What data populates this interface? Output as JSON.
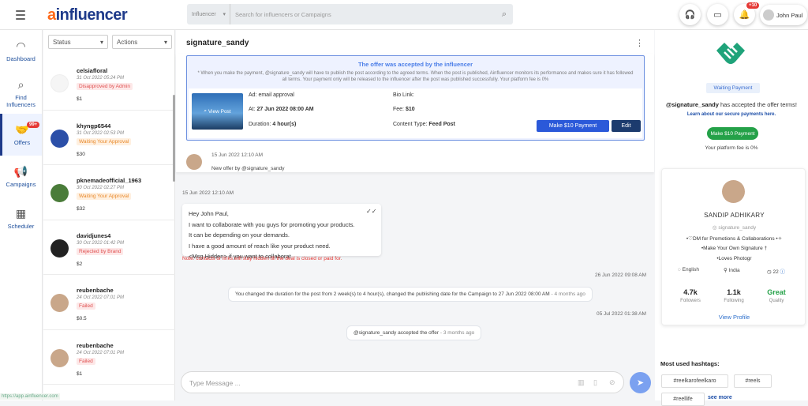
{
  "app": {
    "logo_a": "a",
    "logo_rest": "influencer"
  },
  "search": {
    "category": "Influencer",
    "placeholder": "Search for influencers or Campaigns"
  },
  "header": {
    "notifications_badge": "+10",
    "user_name": "John Paul"
  },
  "sidenav": {
    "items": [
      {
        "label": "Dashboard",
        "icon": "dashboard-gauge-icon"
      },
      {
        "label": "Find Influencers",
        "icon": "magnifier-icon"
      },
      {
        "label": "Offers",
        "icon": "handshake-icon",
        "badge": "99+",
        "active": true
      },
      {
        "label": "Campaigns",
        "icon": "megaphone-icon"
      },
      {
        "label": "Scheduler",
        "icon": "calendar-icon"
      }
    ]
  },
  "filters": {
    "status": "Status",
    "actions": "Actions"
  },
  "offers": [
    {
      "name": "celsiafloral",
      "date": "31 Oct 2022 05:24 PM",
      "status": "Disapproved by Admin",
      "status_color": "red",
      "price": "$1"
    },
    {
      "name": "khyngp6544",
      "date": "31 Oct 2022 02:53 PM",
      "status": "Waiting Your Approval",
      "status_color": "orange",
      "price": "$30"
    },
    {
      "name": "pknemadeofficial_1963",
      "date": "30 Oct 2022 02:27 PM",
      "status": "Waiting Your Approval",
      "status_color": "orange",
      "price": "$32"
    },
    {
      "name": "davidjunes4",
      "date": "30 Oct 2022 01:42 PM",
      "status": "Rejected by Brand",
      "status_color": "red",
      "price": "$2"
    },
    {
      "name": "reubenbache",
      "date": "24 Oct 2022 07:01 PM",
      "status": "Failed",
      "status_color": "red",
      "price": "$0.5"
    },
    {
      "name": "reubenbache",
      "date": "24 Oct 2022 07:01 PM",
      "status": "Failed",
      "status_color": "red",
      "price": "$1"
    }
  ],
  "chat": {
    "title": "signature_sandy",
    "offer": {
      "heading": "The offer was accepted by the influencer",
      "description": "* When you make the payment, @signature_sandy will have to publish the post according to the agreed terms. When the post is published, Ainfluencer monitors its performance and makes sure it has followed all terms. Your payment only will be released to the influencer after the post was published successfully. Your platform fee is 0%",
      "view_post": "View Post",
      "ad": "Ad: email approval",
      "at_label": "At:",
      "at_value": "27 Jun 2022 08:00 AM",
      "duration_label": "Duration:",
      "duration_value": "4 hour(s)",
      "bio_link": "Bio Link:",
      "fee_label": "Fee:",
      "fee_value": "$10",
      "content_label": "Content Type:",
      "content_value": "Feed Post",
      "pay_button": "Make $10 Payment",
      "edit_button": "Edit"
    },
    "messages": {
      "m1_time": "15 Jun 2022 12:10 AM",
      "m1_text": "New offer by @signature_sandy",
      "m2_time": "15 Jun 2022 12:10 AM",
      "bubble": [
        "Hey John Paul,",
        "I want to collaborate with you guys for promoting your products.",
        "It can be depending on your demands.",
        "I have a good amount of reach like your product need.",
        "<Msg Hidden> if you want to collaborat"
      ],
      "note": "Note: contacts or links will stay hidden till the deal is closed or paid for.",
      "ts1": "26 Jun 2022 09:08 AM",
      "sys1": "You changed the duration for the post from 2 week(s) to 4 hour(s), changed the publishing date for the Campaign to 27 Jun 2022 08:00 AM",
      "sys1_ago": "- 4 months ago",
      "ts2": "05 Jul 2022 01:38 AM",
      "sys2": "@signature_sandy accepted the offer",
      "sys2_ago": "- 3 months ago"
    },
    "composer_placeholder": "Type Message ..."
  },
  "panel": {
    "status": "Waiting Payment",
    "accepted_user": "@signature_sandy",
    "accepted_text": " has accepted the offer terms!",
    "learn": "Learn about our secure payments here.",
    "pay_button": "Make $10 Payment",
    "platform_fee": "Your platform fee is 0%",
    "profile": {
      "name": "SANDIP ADHIKARY",
      "handle": "signature_sandy",
      "bio": [
        "•♡DM for Promotions & Collaborations •✧",
        "•Make Your Own Signature †",
        "•Loves Photogr"
      ],
      "language": "English",
      "country": "India",
      "age": "22",
      "followers_value": "4.7k",
      "followers_label": "Followers",
      "following_value": "1.1k",
      "following_label": "Following",
      "quality_value": "Great",
      "quality_label": "Quality",
      "view_profile": "View Profile"
    },
    "hashtags_title": "Most used hashtags:",
    "hashtags": [
      "#reelkarofeelkaro",
      "#reels",
      "#reellife"
    ],
    "see_more": "see more"
  },
  "footer_url": "https://app.ainfluencer.com",
  "colors": {
    "brand_orange": "#ff6a1a",
    "brand_navy": "#1e3a8a",
    "accent_blue": "#2b59d9",
    "success": "#24a148"
  }
}
